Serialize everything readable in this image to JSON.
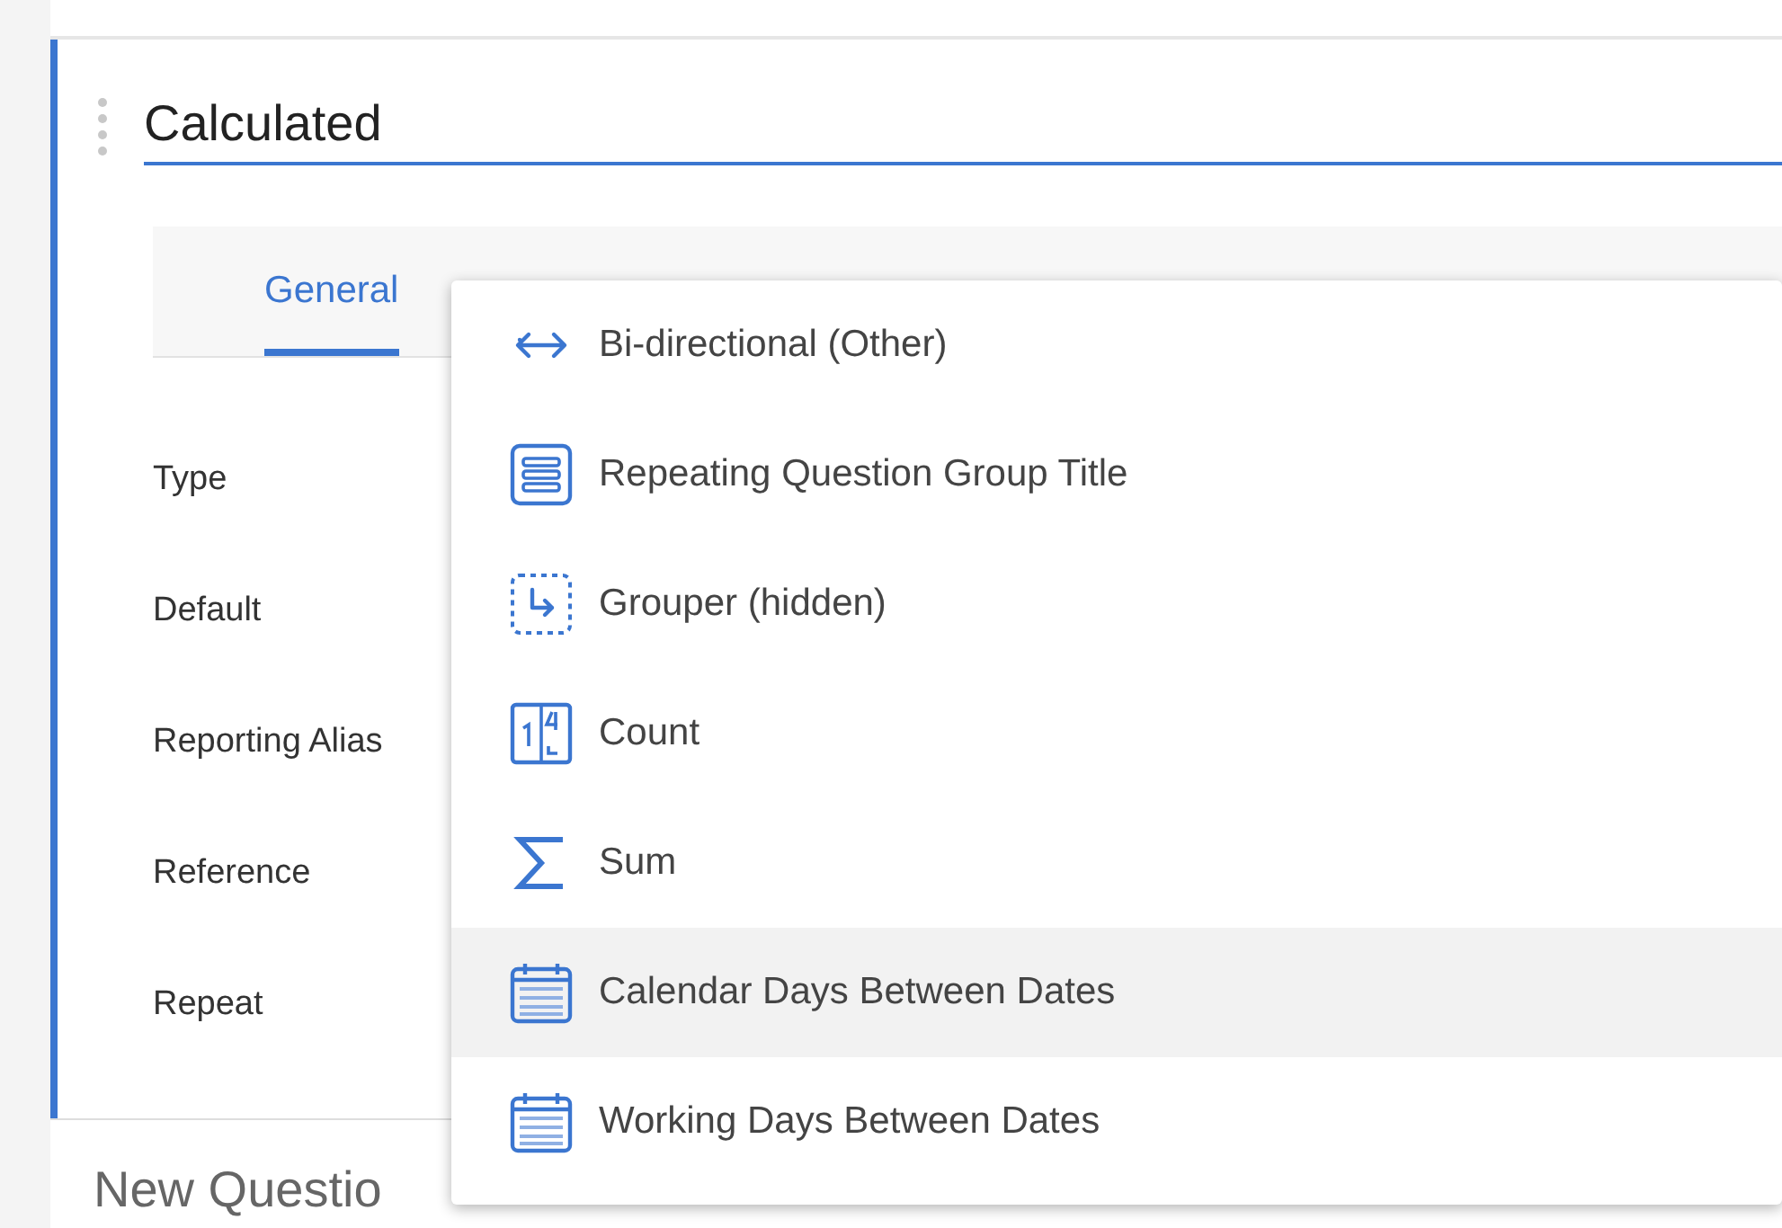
{
  "title": "Calculated",
  "tabs": [
    {
      "label": "General",
      "selected": true
    }
  ],
  "fields": [
    {
      "label": "Type"
    },
    {
      "label": "Default"
    },
    {
      "label": "Reporting Alias"
    },
    {
      "label": "Reference"
    },
    {
      "label": "Repeat"
    }
  ],
  "next_question": {
    "title": "New Questio"
  },
  "menu": {
    "items": [
      {
        "label": "Bi-directional (Other)",
        "kind": "bidirectional",
        "highlighted": false
      },
      {
        "label": "Repeating Question Group Title",
        "kind": "group",
        "highlighted": false
      },
      {
        "label": "Grouper (hidden)",
        "kind": "grouper",
        "highlighted": false
      },
      {
        "label": "Count",
        "kind": "count",
        "highlighted": false
      },
      {
        "label": "Sum",
        "kind": "sum",
        "highlighted": false
      },
      {
        "label": "Calendar Days Between Dates",
        "kind": "calendar",
        "highlighted": true
      },
      {
        "label": "Working Days Between Dates",
        "kind": "calendar",
        "highlighted": false
      }
    ]
  }
}
